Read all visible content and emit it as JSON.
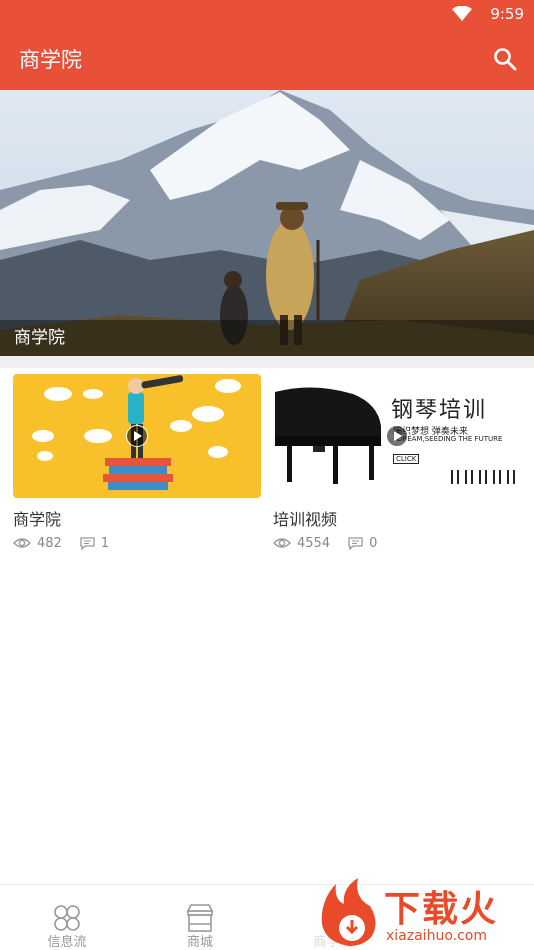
{
  "status_bar": {
    "time": "9:59"
  },
  "app_bar": {
    "title": "商学院"
  },
  "banner": {
    "caption": "商学院"
  },
  "cards": [
    {
      "name": "商学院",
      "views": "482",
      "comments": "1"
    },
    {
      "name": "培训视频",
      "views": "4554",
      "comments": "0",
      "thumb_text": {
        "headline": "钢琴培训",
        "sub1": "编织梦想 弹奏未来",
        "sub2": "DREAM,SEEDING THE FUTURE",
        "click": "CLICK"
      }
    }
  ],
  "bottom_nav": [
    {
      "label": "信息流",
      "icon": "grid-icon"
    },
    {
      "label": "商城",
      "icon": "store-icon"
    },
    {
      "label": "商学院",
      "icon": "book-icon"
    }
  ],
  "watermark": {
    "text": "下载火",
    "sub": "xiazaihuo.com"
  },
  "colors": {
    "primary": "#e95038",
    "nav_inactive": "#999999"
  }
}
